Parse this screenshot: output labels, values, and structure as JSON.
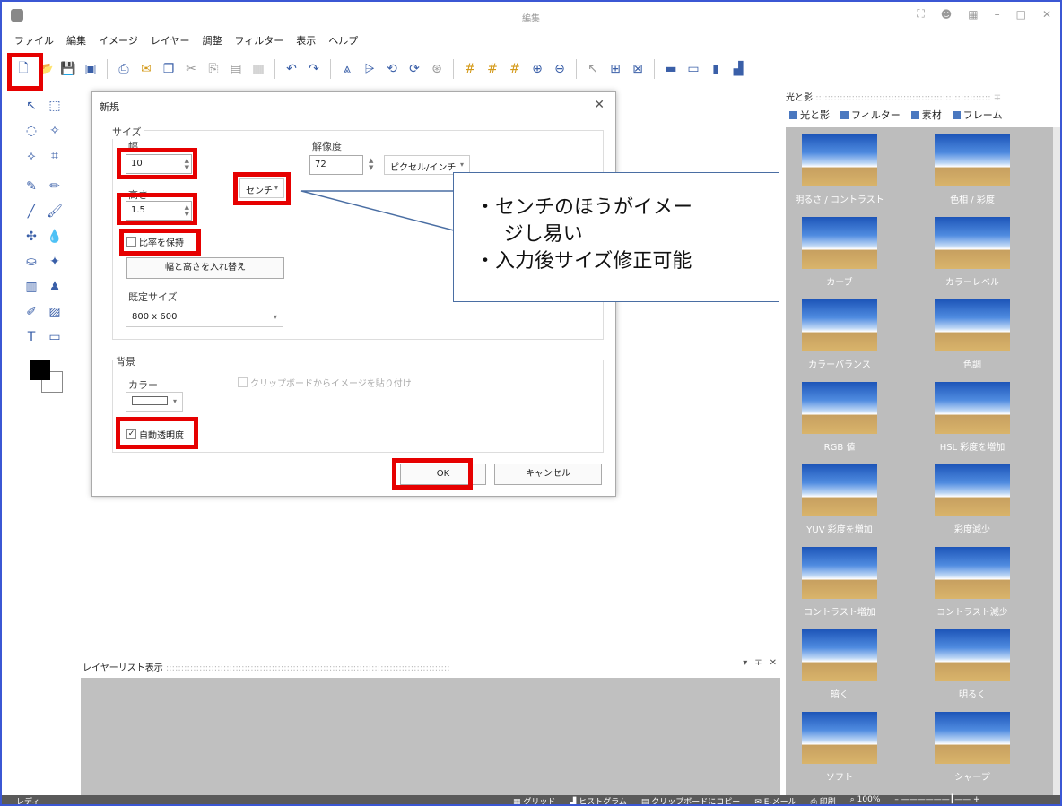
{
  "window": {
    "title": "編集"
  },
  "menu": [
    "ファイル",
    "編集",
    "イメージ",
    "レイヤー",
    "調整",
    "フィルター",
    "表示",
    "ヘルプ"
  ],
  "dialog": {
    "title": "新規",
    "size_group": "サイズ",
    "width_label": "幅",
    "width_value": "10",
    "height_label": "高さ",
    "height_value": "1.5",
    "unit": "センチ",
    "resolution_label": "解像度",
    "resolution_value": "72",
    "resolution_unit": "ピクセル/インチ",
    "keep_ratio": "比率を保持",
    "swap_button": "幅と高さを入れ替え",
    "preset_label": "既定サイズ",
    "preset_value": "800 x 600",
    "background_group": "背景",
    "color_label": "カラー",
    "clipboard_option": "クリップボードからイメージを貼り付け",
    "auto_transparency": "自動透明度",
    "ok": "OK",
    "cancel": "キャンセル"
  },
  "callout": {
    "lines": [
      "センチのほうがイメージし易い",
      "入力後サイズ修正可能"
    ],
    "line1a": "センチのほうがイメー",
    "line1b": "ジし易い"
  },
  "right_panel": {
    "title": "光と影",
    "tabs": [
      "光と影",
      "フィルター",
      "素材",
      "フレーム"
    ],
    "items": [
      "明るさ / コントラスト",
      "色相 / 彩度",
      "カーブ",
      "カラーレベル",
      "カラーバランス",
      "色調",
      "RGB 値",
      "HSL 彩度を増加",
      "YUV 彩度を増加",
      "彩度減少",
      "コントラスト増加",
      "コントラスト減少",
      "暗く",
      "明るく",
      "ソフト",
      "シャープ"
    ]
  },
  "layers": {
    "title": "レイヤーリスト表示"
  },
  "status": {
    "left": "レディ",
    "grid": "グリッド",
    "histogram": "ヒストグラム",
    "copy": "クリップボードにコピー",
    "email": "E-メール",
    "print": "印刷",
    "zoom": "100%"
  },
  "colors": {
    "highlight": "#e60000",
    "frame": "#3b57d4",
    "panel_bg": "#bdbdbd"
  }
}
